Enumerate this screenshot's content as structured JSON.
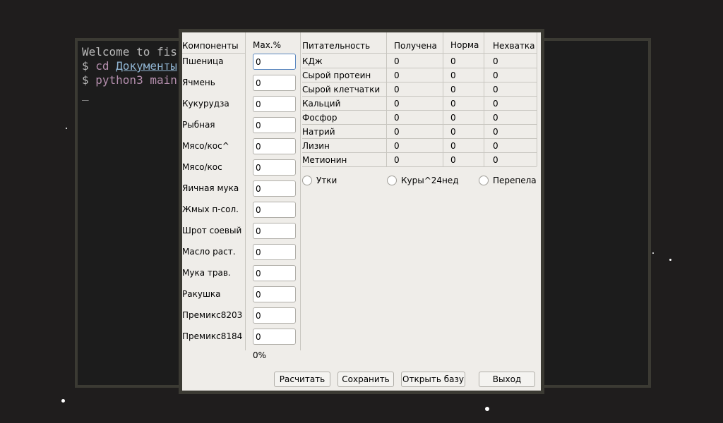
{
  "terminal": {
    "lines": [
      "Welcome to fis",
      "$ cd Документы",
      "$ python3 main",
      "_"
    ]
  },
  "components": {
    "header": "Компоненты",
    "max_header": "Max.%",
    "total": "0%",
    "items": [
      {
        "label": "Пшеница",
        "value": "0"
      },
      {
        "label": "Ячмень",
        "value": "0"
      },
      {
        "label": "Кукурудза",
        "value": "0"
      },
      {
        "label": "Рыбная",
        "value": "0"
      },
      {
        "label": "Мясо/кос^",
        "value": "0"
      },
      {
        "label": "Мясо/кос",
        "value": "0"
      },
      {
        "label": "Яичная мука",
        "value": "0"
      },
      {
        "label": "Жмых п-сол.",
        "value": "0"
      },
      {
        "label": "Шрот соевый",
        "value": "0"
      },
      {
        "label": "Масло раст.",
        "value": "0"
      },
      {
        "label": "Мука трав.",
        "value": "0"
      },
      {
        "label": "Ракушка",
        "value": "0"
      },
      {
        "label": "Премикс8203",
        "value": "0"
      },
      {
        "label": "Премикс8184",
        "value": "0"
      }
    ]
  },
  "nutrition": {
    "headers": [
      "Питательность",
      "Получена",
      "Норма",
      "Нехватка"
    ],
    "rows": [
      [
        "КДж",
        "0",
        "0",
        "0"
      ],
      [
        "Сырой протеин",
        "0",
        "0",
        "0"
      ],
      [
        "Сырой клетчатки",
        "0",
        "0",
        "0"
      ],
      [
        "Кальций",
        "0",
        "0",
        "0"
      ],
      [
        "Фосфор",
        "0",
        "0",
        "0"
      ],
      [
        "Натрий",
        "0",
        "0",
        "0"
      ],
      [
        "Лизин",
        "0",
        "0",
        "0"
      ],
      [
        "Метионин",
        "0",
        "0",
        "0"
      ]
    ]
  },
  "radios": [
    "Утки",
    "Куры^24нед",
    "Перепела"
  ],
  "buttons": {
    "calculate": "Расчитать",
    "save": "Сохранить",
    "open_db": "Открыть базу",
    "exit": "Выход"
  }
}
